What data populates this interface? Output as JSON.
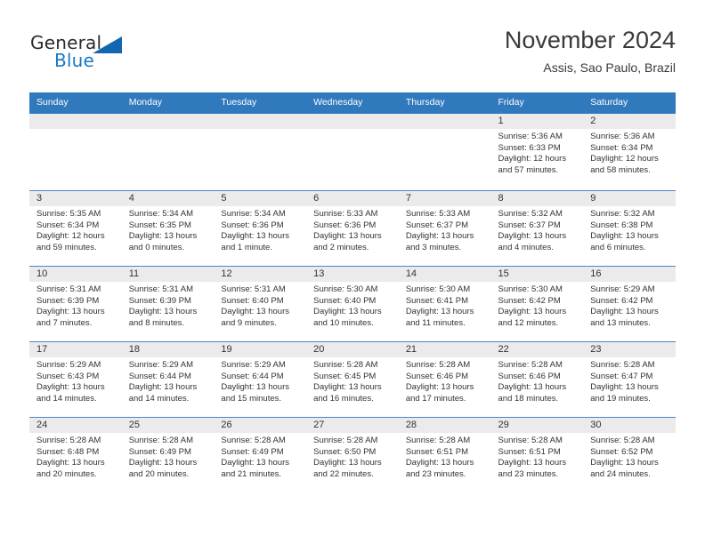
{
  "brand": {
    "word_general": "General",
    "word_blue": "Blue",
    "triangle_color": "#1267b0"
  },
  "header": {
    "title": "November 2024",
    "location": "Assis, Sao Paulo, Brazil"
  },
  "theme": {
    "header_row_bg": "#3179bd",
    "daynum_band_bg": "#ebebeb",
    "row_divider": "#4a86c5",
    "text": "#333333"
  },
  "weekday_headers": [
    "Sunday",
    "Monday",
    "Tuesday",
    "Wednesday",
    "Thursday",
    "Friday",
    "Saturday"
  ],
  "weeks": [
    [
      {
        "day": "",
        "sunrise": "",
        "sunset": "",
        "daylight1": "",
        "daylight2": ""
      },
      {
        "day": "",
        "sunrise": "",
        "sunset": "",
        "daylight1": "",
        "daylight2": ""
      },
      {
        "day": "",
        "sunrise": "",
        "sunset": "",
        "daylight1": "",
        "daylight2": ""
      },
      {
        "day": "",
        "sunrise": "",
        "sunset": "",
        "daylight1": "",
        "daylight2": ""
      },
      {
        "day": "",
        "sunrise": "",
        "sunset": "",
        "daylight1": "",
        "daylight2": ""
      },
      {
        "day": "1",
        "sunrise": "Sunrise: 5:36 AM",
        "sunset": "Sunset: 6:33 PM",
        "daylight1": "Daylight: 12 hours",
        "daylight2": "and 57 minutes."
      },
      {
        "day": "2",
        "sunrise": "Sunrise: 5:36 AM",
        "sunset": "Sunset: 6:34 PM",
        "daylight1": "Daylight: 12 hours",
        "daylight2": "and 58 minutes."
      }
    ],
    [
      {
        "day": "3",
        "sunrise": "Sunrise: 5:35 AM",
        "sunset": "Sunset: 6:34 PM",
        "daylight1": "Daylight: 12 hours",
        "daylight2": "and 59 minutes."
      },
      {
        "day": "4",
        "sunrise": "Sunrise: 5:34 AM",
        "sunset": "Sunset: 6:35 PM",
        "daylight1": "Daylight: 13 hours",
        "daylight2": "and 0 minutes."
      },
      {
        "day": "5",
        "sunrise": "Sunrise: 5:34 AM",
        "sunset": "Sunset: 6:36 PM",
        "daylight1": "Daylight: 13 hours",
        "daylight2": "and 1 minute."
      },
      {
        "day": "6",
        "sunrise": "Sunrise: 5:33 AM",
        "sunset": "Sunset: 6:36 PM",
        "daylight1": "Daylight: 13 hours",
        "daylight2": "and 2 minutes."
      },
      {
        "day": "7",
        "sunrise": "Sunrise: 5:33 AM",
        "sunset": "Sunset: 6:37 PM",
        "daylight1": "Daylight: 13 hours",
        "daylight2": "and 3 minutes."
      },
      {
        "day": "8",
        "sunrise": "Sunrise: 5:32 AM",
        "sunset": "Sunset: 6:37 PM",
        "daylight1": "Daylight: 13 hours",
        "daylight2": "and 4 minutes."
      },
      {
        "day": "9",
        "sunrise": "Sunrise: 5:32 AM",
        "sunset": "Sunset: 6:38 PM",
        "daylight1": "Daylight: 13 hours",
        "daylight2": "and 6 minutes."
      }
    ],
    [
      {
        "day": "10",
        "sunrise": "Sunrise: 5:31 AM",
        "sunset": "Sunset: 6:39 PM",
        "daylight1": "Daylight: 13 hours",
        "daylight2": "and 7 minutes."
      },
      {
        "day": "11",
        "sunrise": "Sunrise: 5:31 AM",
        "sunset": "Sunset: 6:39 PM",
        "daylight1": "Daylight: 13 hours",
        "daylight2": "and 8 minutes."
      },
      {
        "day": "12",
        "sunrise": "Sunrise: 5:31 AM",
        "sunset": "Sunset: 6:40 PM",
        "daylight1": "Daylight: 13 hours",
        "daylight2": "and 9 minutes."
      },
      {
        "day": "13",
        "sunrise": "Sunrise: 5:30 AM",
        "sunset": "Sunset: 6:40 PM",
        "daylight1": "Daylight: 13 hours",
        "daylight2": "and 10 minutes."
      },
      {
        "day": "14",
        "sunrise": "Sunrise: 5:30 AM",
        "sunset": "Sunset: 6:41 PM",
        "daylight1": "Daylight: 13 hours",
        "daylight2": "and 11 minutes."
      },
      {
        "day": "15",
        "sunrise": "Sunrise: 5:30 AM",
        "sunset": "Sunset: 6:42 PM",
        "daylight1": "Daylight: 13 hours",
        "daylight2": "and 12 minutes."
      },
      {
        "day": "16",
        "sunrise": "Sunrise: 5:29 AM",
        "sunset": "Sunset: 6:42 PM",
        "daylight1": "Daylight: 13 hours",
        "daylight2": "and 13 minutes."
      }
    ],
    [
      {
        "day": "17",
        "sunrise": "Sunrise: 5:29 AM",
        "sunset": "Sunset: 6:43 PM",
        "daylight1": "Daylight: 13 hours",
        "daylight2": "and 14 minutes."
      },
      {
        "day": "18",
        "sunrise": "Sunrise: 5:29 AM",
        "sunset": "Sunset: 6:44 PM",
        "daylight1": "Daylight: 13 hours",
        "daylight2": "and 14 minutes."
      },
      {
        "day": "19",
        "sunrise": "Sunrise: 5:29 AM",
        "sunset": "Sunset: 6:44 PM",
        "daylight1": "Daylight: 13 hours",
        "daylight2": "and 15 minutes."
      },
      {
        "day": "20",
        "sunrise": "Sunrise: 5:28 AM",
        "sunset": "Sunset: 6:45 PM",
        "daylight1": "Daylight: 13 hours",
        "daylight2": "and 16 minutes."
      },
      {
        "day": "21",
        "sunrise": "Sunrise: 5:28 AM",
        "sunset": "Sunset: 6:46 PM",
        "daylight1": "Daylight: 13 hours",
        "daylight2": "and 17 minutes."
      },
      {
        "day": "22",
        "sunrise": "Sunrise: 5:28 AM",
        "sunset": "Sunset: 6:46 PM",
        "daylight1": "Daylight: 13 hours",
        "daylight2": "and 18 minutes."
      },
      {
        "day": "23",
        "sunrise": "Sunrise: 5:28 AM",
        "sunset": "Sunset: 6:47 PM",
        "daylight1": "Daylight: 13 hours",
        "daylight2": "and 19 minutes."
      }
    ],
    [
      {
        "day": "24",
        "sunrise": "Sunrise: 5:28 AM",
        "sunset": "Sunset: 6:48 PM",
        "daylight1": "Daylight: 13 hours",
        "daylight2": "and 20 minutes."
      },
      {
        "day": "25",
        "sunrise": "Sunrise: 5:28 AM",
        "sunset": "Sunset: 6:49 PM",
        "daylight1": "Daylight: 13 hours",
        "daylight2": "and 20 minutes."
      },
      {
        "day": "26",
        "sunrise": "Sunrise: 5:28 AM",
        "sunset": "Sunset: 6:49 PM",
        "daylight1": "Daylight: 13 hours",
        "daylight2": "and 21 minutes."
      },
      {
        "day": "27",
        "sunrise": "Sunrise: 5:28 AM",
        "sunset": "Sunset: 6:50 PM",
        "daylight1": "Daylight: 13 hours",
        "daylight2": "and 22 minutes."
      },
      {
        "day": "28",
        "sunrise": "Sunrise: 5:28 AM",
        "sunset": "Sunset: 6:51 PM",
        "daylight1": "Daylight: 13 hours",
        "daylight2": "and 23 minutes."
      },
      {
        "day": "29",
        "sunrise": "Sunrise: 5:28 AM",
        "sunset": "Sunset: 6:51 PM",
        "daylight1": "Daylight: 13 hours",
        "daylight2": "and 23 minutes."
      },
      {
        "day": "30",
        "sunrise": "Sunrise: 5:28 AM",
        "sunset": "Sunset: 6:52 PM",
        "daylight1": "Daylight: 13 hours",
        "daylight2": "and 24 minutes."
      }
    ]
  ]
}
